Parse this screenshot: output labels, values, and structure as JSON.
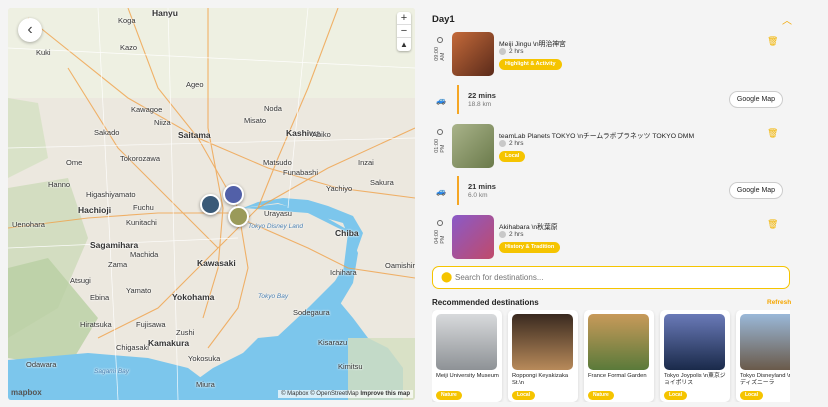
{
  "map": {
    "back_icon": "chevron-left-icon",
    "zoom_in": "+",
    "zoom_out": "−",
    "compass": "▲",
    "cities": [
      "Hanyu",
      "Koga",
      "Kuki",
      "Kazo",
      "Sakado",
      "Saitama",
      "Kashiwa",
      "Tokorozawa",
      "Matsudo",
      "Funabashi",
      "Ageo",
      "Kawagoe",
      "Yachiyo",
      "Hachioji",
      "Fuchu",
      "Urayasu",
      "Chiba",
      "Sagamihara",
      "Kawasaki",
      "Yokohama",
      "Ichihara",
      "Oamishirasato",
      "Kamakura",
      "Yokosuka",
      "Odawara",
      "Sodegaura",
      "Kisarazu",
      "Ome",
      "Hanno",
      "Uenohara",
      "Hiratsuka",
      "Fujisawa",
      "Atsugi",
      "Chigasaki",
      "Tokyo Bay",
      "Sagami Bay",
      "Noda",
      "Abiko",
      "Inzai",
      "Sakura",
      "Tokyo Disney Land",
      "Misato",
      "Niiza",
      "Kunitachi",
      "Higashiyamato",
      "Machida",
      "Zama",
      "Ebina",
      "Yamato",
      "Zushi",
      "Miura",
      "Kimitsu"
    ],
    "attribution": "© Mapbox © OpenStreetMap",
    "improve": "Improve this map",
    "logo": "mapbox"
  },
  "colors": {
    "accent": "#f5c400",
    "water": "#7cc6ec",
    "land": "#ece8df"
  },
  "day": {
    "label": "Day1",
    "chevron_icon": "chevron-up-icon"
  },
  "itinerary": [
    {
      "time": "09:00 AM",
      "title": "Meiji Jingu \\n明治神宮",
      "duration": "2 hrs",
      "tag": "Highlight & Activity",
      "thumb": "#8b4a2c"
    },
    {
      "time": "01:00 PM",
      "title": "teamLab Planets TOKYO \\nチームラボプラネッツ TOKYO DMM",
      "duration": "2 hrs",
      "tag": "Local",
      "thumb": "#9aa37a"
    },
    {
      "time": "04:00 PM",
      "title": "Akihabara \\n秋葉原",
      "duration": "2 hrs",
      "tag": "History & Tradition",
      "thumb": "#6a4d9a"
    }
  ],
  "travel": [
    {
      "mins": "22 mins",
      "km": "18.8 km",
      "button": "Google Map"
    },
    {
      "mins": "21 mins",
      "km": "6.0 km",
      "button": "Google Map"
    }
  ],
  "search": {
    "placeholder": "Search for destinations..."
  },
  "recommended": {
    "title": "Recommended destinations",
    "refresh": "Refresh",
    "cards": [
      {
        "name": "Meiji University Museum",
        "tag": "Nature",
        "color": "#b8bcc0"
      },
      {
        "name": "Roppongi Keyakizaka St.\\n",
        "tag": "Local",
        "color": "#5a3e2c"
      },
      {
        "name": "France Formal Garden",
        "tag": "Nature",
        "color": "#8a6f3c"
      },
      {
        "name": "Tokyo Joypolis \\n東京ジョイポリス",
        "tag": "Local",
        "color": "#2c3e6a"
      },
      {
        "name": "Tokyo Disneyland \\n東京ディズニーラ",
        "tag": "Local",
        "color": "#7a8fa8"
      }
    ]
  }
}
